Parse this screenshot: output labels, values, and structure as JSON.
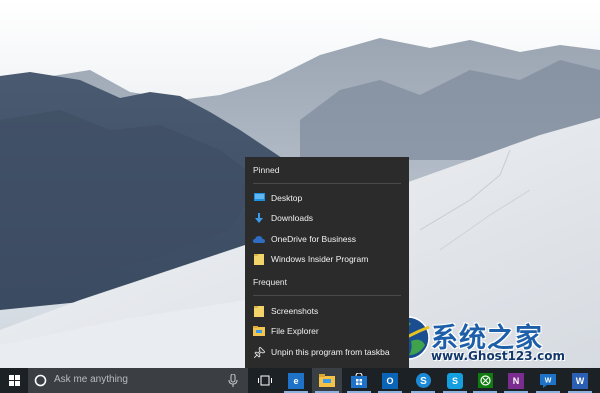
{
  "jumplist": {
    "pinned_header": "Pinned",
    "pinned": [
      {
        "label": "Desktop",
        "icon": "desktop-folder-icon"
      },
      {
        "label": "Downloads",
        "icon": "downloads-arrow-icon"
      },
      {
        "label": "OneDrive for Business",
        "icon": "onedrive-cloud-icon"
      },
      {
        "label": "Windows Insider Program",
        "icon": "folder-icon"
      }
    ],
    "frequent_header": "Frequent",
    "frequent": [
      {
        "label": "Screenshots",
        "icon": "folder-icon"
      },
      {
        "label": "File Explorer",
        "icon": "file-explorer-icon"
      }
    ],
    "unpin_label": "Unpin this program from taskba"
  },
  "taskbar": {
    "search_placeholder": "Ask me anything",
    "apps": [
      {
        "name": "task-view",
        "icon": "task-view-icon"
      },
      {
        "name": "edge",
        "icon": "edge-browser-icon",
        "color": "#1e73c9"
      },
      {
        "name": "file-explorer",
        "icon": "file-explorer-icon",
        "color": "#f4c244",
        "active": true
      },
      {
        "name": "store",
        "icon": "store-icon",
        "color": "#1e73c9"
      },
      {
        "name": "outlook",
        "icon": "outlook-icon",
        "color": "#0a64b8"
      },
      {
        "name": "skype-for-business",
        "icon": "skype-business-icon",
        "color": "#1b8ad6"
      },
      {
        "name": "skype",
        "icon": "skype-icon",
        "color": "#14a0e0"
      },
      {
        "name": "xbox",
        "icon": "xbox-icon",
        "color": "#107c10"
      },
      {
        "name": "onenote",
        "icon": "onenote-icon",
        "color": "#7b2c8f"
      },
      {
        "name": "feedback",
        "icon": "feedback-icon",
        "color": "#1e73c9"
      },
      {
        "name": "word",
        "icon": "word-icon",
        "color": "#2b5fb4"
      }
    ]
  },
  "watermark": {
    "title": "系统之家",
    "url": "www.Ghost123.com"
  },
  "colors": {
    "menu_bg": "#2b2b2b",
    "taskbar_bg": "#1c2126",
    "accent": "#1e73c9",
    "watermark_blue": "#1d5fa8"
  }
}
